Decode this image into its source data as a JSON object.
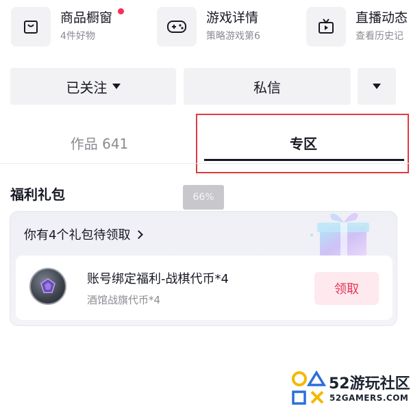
{
  "shortcuts": [
    {
      "title": "商品橱窗",
      "subtitle": "4件好物",
      "icon": "shopping-bag-icon",
      "has_dot": true
    },
    {
      "title": "游戏详情",
      "subtitle": "策略游戏第6",
      "icon": "gamepad-icon",
      "has_dot": false
    },
    {
      "title": "直播动态",
      "subtitle": "查看历史记",
      "icon": "tv-icon",
      "has_dot": false
    }
  ],
  "actions": {
    "follow_label": "已关注",
    "message_label": "私信"
  },
  "tabs": {
    "works_label": "作品 641",
    "zone_label": "专区"
  },
  "section": {
    "title": "福利礼包"
  },
  "progress_badge": "66%",
  "gift": {
    "header": "你有4个礼包待领取",
    "name": "账号绑定福利-战棋代币*4",
    "description": "酒馆战旗代币*4",
    "claim_label": "领取"
  },
  "watermark": {
    "brand": "52游玩社区",
    "url": "52GAMERS.COM"
  },
  "colors": {
    "accent_red": "#fe2c55",
    "highlight_box": "#e0393e",
    "claim_text": "#e8315a"
  }
}
